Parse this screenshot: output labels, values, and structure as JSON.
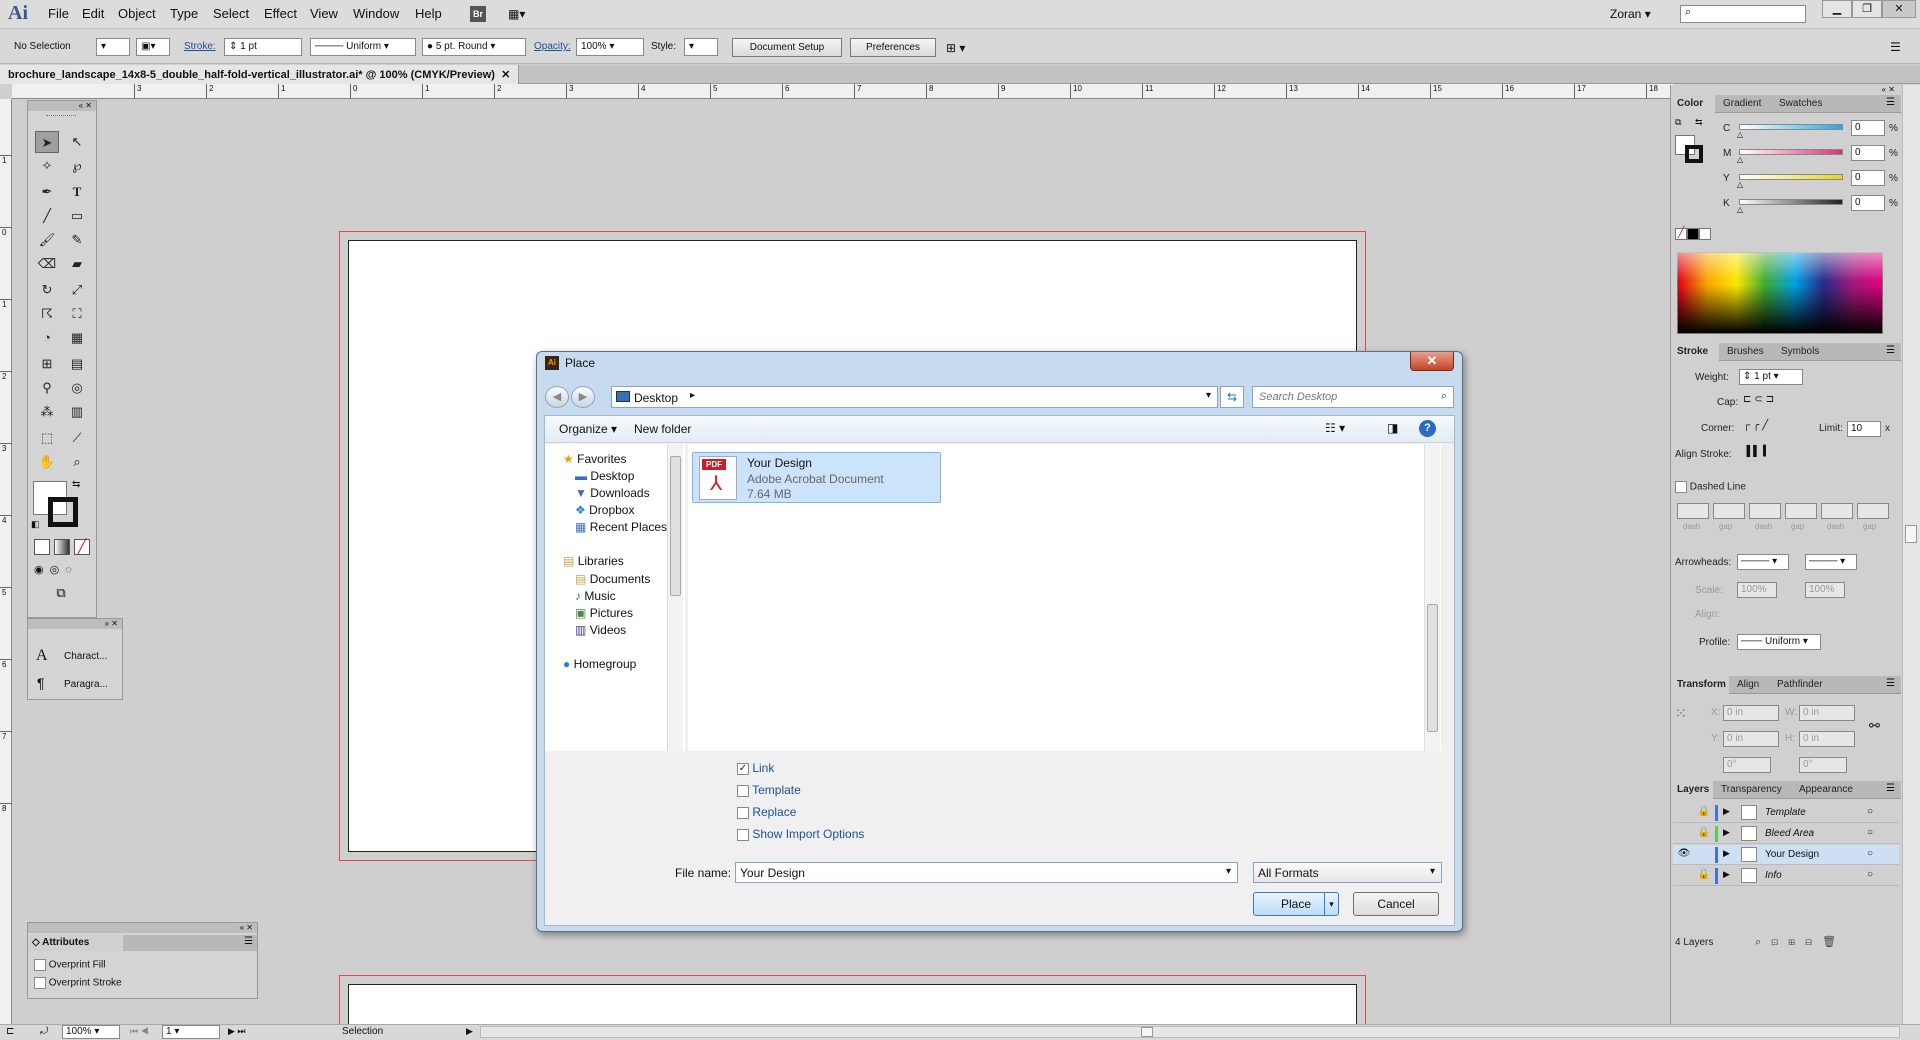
{
  "menubar": {
    "logo": "Ai",
    "items": [
      "File",
      "Edit",
      "Object",
      "Type",
      "Select",
      "Effect",
      "View",
      "Window",
      "Help"
    ],
    "bridge": "Br",
    "user": "Zoran",
    "search_placeholder": ""
  },
  "control": {
    "selection": "No Selection",
    "stroke_label": "Stroke:",
    "stroke_value": "1 pt",
    "profile": "Uniform",
    "brush": "5 pt. Round",
    "opacity_label": "Opacity:",
    "opacity_value": "100%",
    "style_label": "Style:",
    "doc_setup": "Document Setup",
    "preferences": "Preferences"
  },
  "document": {
    "tab_title": "brochure_landscape_14x8-5_double_half-fold-vertical_illustrator.ai* @ 100% (CMYK/Preview)",
    "ruler_h": [
      "3",
      "2",
      "1",
      "0",
      "1",
      "2",
      "3",
      "4",
      "5",
      "6",
      "7",
      "8",
      "9",
      "10",
      "11",
      "12",
      "13",
      "14",
      "15",
      "16",
      "17",
      "18"
    ],
    "ruler_v": [
      "1",
      "0",
      "1",
      "2",
      "3",
      "4",
      "5",
      "6",
      "7",
      "8"
    ]
  },
  "left_panels": {
    "character": "Charact...",
    "paragraph": "Paragra...",
    "attributes_title": "Attributes",
    "overprint_fill": "Overprint Fill",
    "overprint_stroke": "Overprint Stroke"
  },
  "color_panel": {
    "tabs": [
      "Color",
      "Gradient",
      "Swatches"
    ],
    "channels": [
      {
        "label": "C",
        "value": "0",
        "unit": "%",
        "color": "#2aa8e0"
      },
      {
        "label": "M",
        "value": "0",
        "unit": "%",
        "color": "#d9307c"
      },
      {
        "label": "Y",
        "value": "0",
        "unit": "%",
        "color": "#e6d420"
      },
      {
        "label": "K",
        "value": "0",
        "unit": "%",
        "color": "#222222"
      }
    ]
  },
  "stroke_panel": {
    "tabs": [
      "Stroke",
      "Brushes",
      "Symbols"
    ],
    "weight_label": "Weight:",
    "weight_value": "1 pt",
    "cap_label": "Cap:",
    "corner_label": "Corner:",
    "limit_label": "Limit:",
    "limit_value": "10",
    "limit_unit": "x",
    "align_label": "Align Stroke:",
    "dashed_label": "Dashed Line",
    "dash_labels": [
      "dash",
      "gap",
      "dash",
      "gap",
      "dash",
      "gap"
    ],
    "arrowheads_label": "Arrowheads:",
    "scale_label": "Scale:",
    "scale_a": "100%",
    "scale_b": "100%",
    "align2_label": "Align:",
    "profile_label": "Profile:",
    "profile_value": "Uniform"
  },
  "transform_panel": {
    "tabs": [
      "Transform",
      "Align",
      "Pathfinder"
    ],
    "x_label": "X:",
    "x_value": "0 in",
    "y_label": "Y:",
    "y_value": "0 in",
    "w_label": "W:",
    "w_value": "0 in",
    "h_label": "H:",
    "h_value": "0 in",
    "rot_value": "0°",
    "shear_value": "0°"
  },
  "layers_panel": {
    "tabs": [
      "Layers",
      "Transparency",
      "Appearance"
    ],
    "layers": [
      {
        "name": "Template",
        "locked": true,
        "visible": false,
        "italic": true,
        "color": "#4a6fd8"
      },
      {
        "name": "Bleed Area",
        "locked": true,
        "visible": false,
        "italic": true,
        "color": "#5ac85a"
      },
      {
        "name": "Your Design",
        "locked": false,
        "visible": true,
        "italic": false,
        "color": "#4a6fd8"
      },
      {
        "name": "Info",
        "locked": true,
        "visible": false,
        "italic": true,
        "color": "#4a6fd8"
      }
    ],
    "count": "4 Layers"
  },
  "dialog": {
    "title": "Place",
    "location": "Desktop",
    "search_placeholder": "Search Desktop",
    "organize": "Organize",
    "new_folder": "New folder",
    "nav": {
      "favorites": "Favorites",
      "favorites_items": [
        "Desktop",
        "Downloads",
        "Dropbox",
        "Recent Places"
      ],
      "libraries": "Libraries",
      "libraries_items": [
        "Documents",
        "Music",
        "Pictures",
        "Videos"
      ],
      "homegroup": "Homegroup"
    },
    "file": {
      "name": "Your Design",
      "type": "Adobe Acrobat Document",
      "size": "7.64 MB",
      "badge": "PDF"
    },
    "options": [
      {
        "label": "Link",
        "checked": true
      },
      {
        "label": "Template",
        "checked": false
      },
      {
        "label": "Replace",
        "checked": false
      },
      {
        "label": "Show Import Options",
        "checked": false
      }
    ],
    "filename_label": "File name:",
    "filename_value": "Your Design",
    "format": "All Formats",
    "place": "Place",
    "cancel": "Cancel"
  },
  "statusbar": {
    "zoom": "100%",
    "page": "1",
    "tool": "Selection"
  }
}
